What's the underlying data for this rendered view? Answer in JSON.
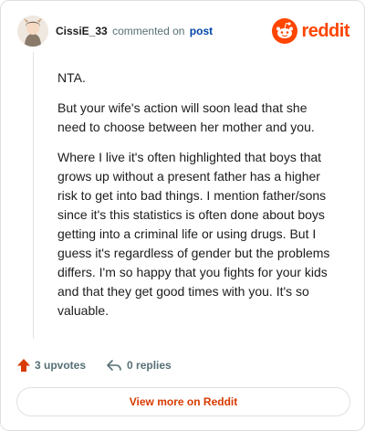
{
  "header": {
    "username": "CissiE_33",
    "action_text": "commented on",
    "post_link": "post",
    "logo_text": "reddit"
  },
  "comment": {
    "paragraphs": [
      "NTA.",
      "But your wife's action will soon lead that she need to choose between her mother and you.",
      "Where I live it's often highlighted that boys that grows up without a present father has a higher risk to get into bad things. I mention father/sons since it's this statistics is often done about boys getting into a criminal life or using drugs. But I guess it's regardless of gender but the problems differs. I'm so happy that you fights for your kids and that they get good times with you. It's so valuable."
    ]
  },
  "footer": {
    "upvotes": "3 upvotes",
    "replies": "0 replies"
  },
  "view_more_label": "View more on Reddit",
  "colors": {
    "brand": "#ff4500",
    "link": "#0045ac",
    "upvote": "#d93a00"
  }
}
